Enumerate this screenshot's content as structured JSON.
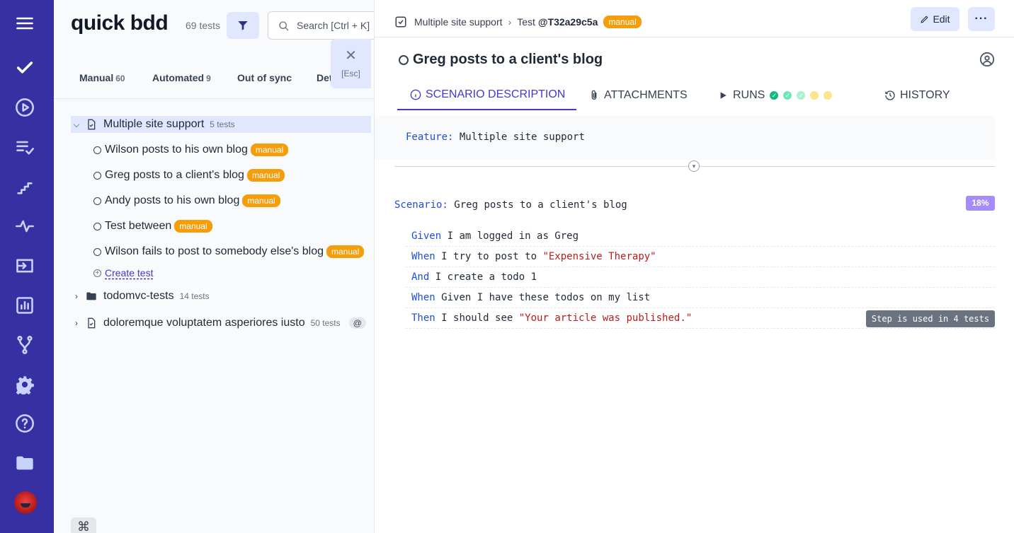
{
  "sidebar": {
    "items": [
      {
        "icon": "menu-icon"
      },
      {
        "icon": "check-icon"
      },
      {
        "icon": "play-circle-icon"
      },
      {
        "icon": "list-check-icon"
      },
      {
        "icon": "steps-icon"
      },
      {
        "icon": "pulse-icon"
      },
      {
        "icon": "import-icon"
      },
      {
        "icon": "analytics-icon"
      },
      {
        "icon": "branch-icon"
      },
      {
        "icon": "gear-icon"
      },
      {
        "icon": "help-icon"
      },
      {
        "icon": "folder-icon"
      }
    ],
    "avatar_icon": "user-avatar"
  },
  "project": {
    "title": "quick bdd",
    "count": "69 tests"
  },
  "search": {
    "placeholder": "Search [Ctrl + K]"
  },
  "close": {
    "icon": "close-icon",
    "shortcut": "[Esc]"
  },
  "left_tabs": [
    {
      "label": "Manual",
      "count": "60"
    },
    {
      "label": "Automated",
      "count": "9"
    },
    {
      "label": "Out of sync",
      "count": ""
    },
    {
      "label": "Det",
      "count": ""
    }
  ],
  "tree": {
    "suite1": {
      "name": "Multiple site support",
      "count": "5 tests"
    },
    "tests": [
      {
        "name": "Wilson posts to his own blog",
        "badge": "manual"
      },
      {
        "name": "Greg posts to a client's blog",
        "badge": "manual"
      },
      {
        "name": "Andy posts to his own blog",
        "badge": "manual"
      },
      {
        "name": "Test between",
        "badge": "manual"
      },
      {
        "name": "Wilson fails to post to somebody else's blog",
        "badge": "manual"
      }
    ],
    "create_label": "Create test",
    "suite2": {
      "name": "todomvc-tests",
      "count": "14 tests"
    },
    "suite3": {
      "name": "doloremque voluptatem asperiores iusto",
      "count": "50 tests",
      "chip": "@"
    }
  },
  "shortcut_key": "⌘",
  "detail": {
    "breadcrumb_suite": "Multiple site support",
    "breadcrumb_sep": "›",
    "test_prefix": "Test",
    "test_id": "@T32a29c5a",
    "badge": "manual",
    "edit_label": "Edit",
    "more_label": "···",
    "title": "Greg posts to a client's blog",
    "tabs": [
      {
        "label": "SCENARIO DESCRIPTION",
        "icon": "info-icon",
        "active": true
      },
      {
        "label": "ATTACHMENTS",
        "icon": "paperclip-icon"
      },
      {
        "label": "RUNS",
        "icon": "play-icon"
      },
      {
        "label": "HISTORY",
        "icon": "history-icon"
      }
    ],
    "run_dots": [
      "#10b981",
      "#6ee7b7",
      "#a7f3d0",
      "#fde68a",
      "#fde68a"
    ],
    "feature_kw": "Feature:",
    "feature_text": "Multiple site support",
    "scenario_kw": "Scenario:",
    "scenario_text": "Greg posts to a client's blog",
    "percent": "18%",
    "steps": [
      {
        "kw": "Given",
        "text": "I am logged in as Greg",
        "str": ""
      },
      {
        "kw": "When",
        "text": "I try to post to",
        "str": "\"Expensive Therapy\""
      },
      {
        "kw": "And",
        "text": "I create a todo 1",
        "str": ""
      },
      {
        "kw": "When",
        "text": "Given I have these todos on my list",
        "str": ""
      },
      {
        "kw": "Then",
        "text": "I should see",
        "str": "\"Your article was published.\""
      }
    ],
    "tooltip": "Step is used in 4 tests"
  },
  "colors": {
    "sidebar": "#3730a3",
    "accent": "#4338ca",
    "badge": "#f59e0b",
    "keyword": "#1d4ed8",
    "string": "#b91c1c",
    "percent": "#a78bfa"
  }
}
